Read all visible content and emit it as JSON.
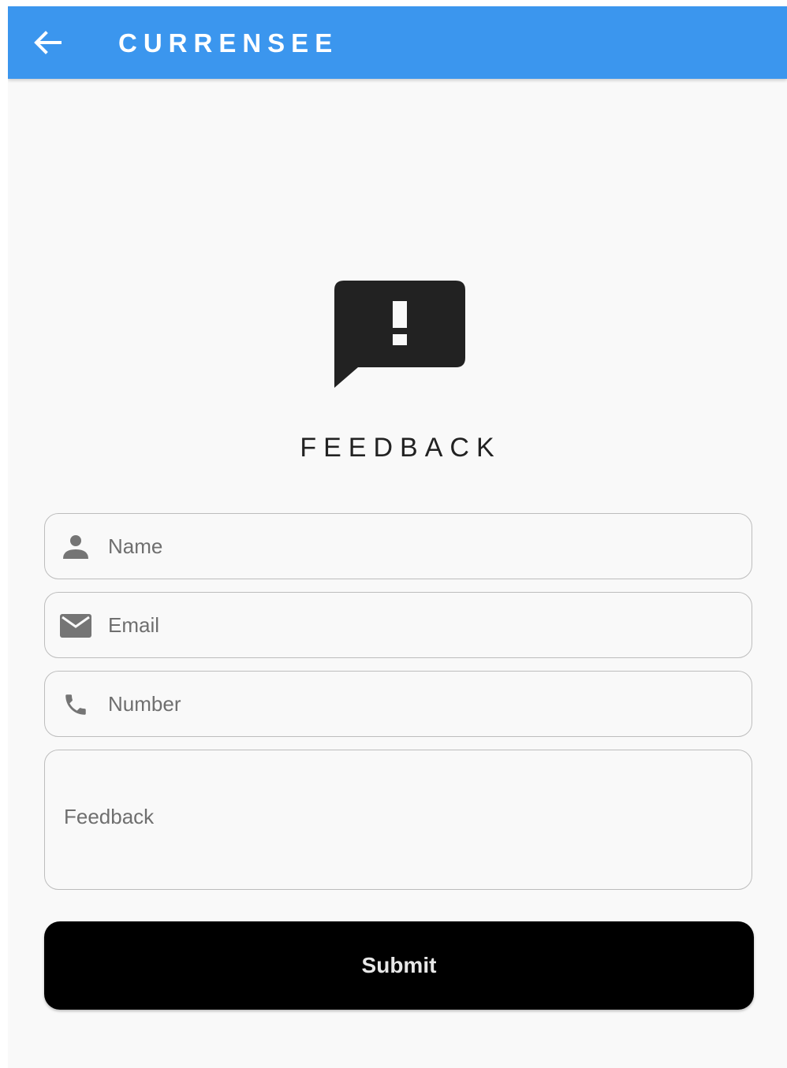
{
  "appbar": {
    "title": "CURRENSEE",
    "back_icon": "arrow-left-icon",
    "background": "#3b96ee"
  },
  "hero": {
    "icon": "feedback-icon",
    "title": "FEEDBACK"
  },
  "form": {
    "name": {
      "placeholder": "Name",
      "icon": "person-icon",
      "value": ""
    },
    "email": {
      "placeholder": "Email",
      "icon": "mail-icon",
      "value": ""
    },
    "number": {
      "placeholder": "Number",
      "icon": "phone-icon",
      "value": ""
    },
    "feedback": {
      "placeholder": "Feedback",
      "value": ""
    },
    "submit_label": "Submit"
  },
  "colors": {
    "page_background": "#f9f9f9",
    "field_border": "#bdbdbd",
    "button_background": "#000000"
  }
}
